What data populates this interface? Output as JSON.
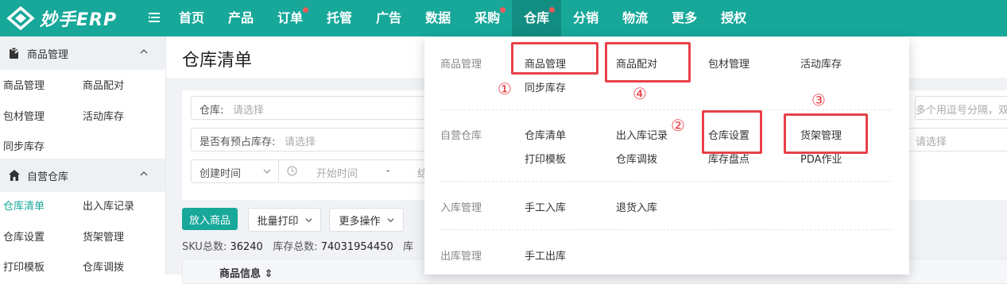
{
  "app": {
    "logo_text": "妙手ERP",
    "accent": "#17a89a"
  },
  "nav": [
    {
      "label": "首页",
      "dot": false
    },
    {
      "label": "产品",
      "dot": false
    },
    {
      "label": "订单",
      "dot": true
    },
    {
      "label": "托管",
      "dot": false
    },
    {
      "label": "广告",
      "dot": false
    },
    {
      "label": "数据",
      "dot": false
    },
    {
      "label": "采购",
      "dot": true
    },
    {
      "label": "仓库",
      "dot": true,
      "active": true
    },
    {
      "label": "分销",
      "dot": false
    },
    {
      "label": "物流",
      "dot": false
    },
    {
      "label": "更多",
      "dot": false
    },
    {
      "label": "授权",
      "dot": false
    }
  ],
  "sidebar": {
    "groups": [
      {
        "label": "商品管理",
        "icon": "clipboard-icon",
        "items": [
          "商品管理",
          "商品配对",
          "包材管理",
          "活动库存",
          "同步库存"
        ]
      },
      {
        "label": "自营仓库",
        "icon": "home-icon",
        "items": [
          "仓库清单",
          "出入库记录",
          "仓库设置",
          "货架管理",
          "打印模板",
          "仓库调拨"
        ]
      }
    ],
    "active_item": "仓库清单"
  },
  "main": {
    "title": "仓库清单",
    "filters": {
      "warehouse_label": "仓库:",
      "warehouse_placeholder": "请选择",
      "presale_label": "是否有预占库存:",
      "presale_placeholder": "请选择",
      "time_type": "创建时间",
      "start_placeholder": "开始时间",
      "range_sep": "-",
      "end_partial": "结",
      "right_hint": "多个用逗号分隔，双",
      "right_select_placeholder": "请选择"
    },
    "actions": {
      "add": "放入商品",
      "batch_print": "批量打印",
      "more": "更多操作"
    },
    "stats": {
      "sku_label": "SKU总数:",
      "sku_value": "36240",
      "stock_label": "库存总数:",
      "stock_value": "74031954450",
      "trailing": "库"
    },
    "table": {
      "header_product": "商品信息 ⇕"
    }
  },
  "dropdown": {
    "sections": [
      {
        "category": "商品管理",
        "items": [
          "商品管理",
          "商品配对",
          "包材管理",
          "活动库存",
          "同步库存"
        ]
      },
      {
        "category": "自营仓库",
        "items": [
          "仓库清单",
          "出入库记录",
          "仓库设置",
          "货架管理",
          "打印模板",
          "仓库调拨",
          "库存盘点",
          "PDA作业"
        ]
      },
      {
        "category": "入库管理",
        "items": [
          "手工入库",
          "退货入库"
        ]
      },
      {
        "category": "出库管理",
        "items": [
          "手工出库"
        ]
      }
    ],
    "markers": [
      "①",
      "②",
      "③",
      "④"
    ],
    "highlight_color": "#e8414a"
  }
}
